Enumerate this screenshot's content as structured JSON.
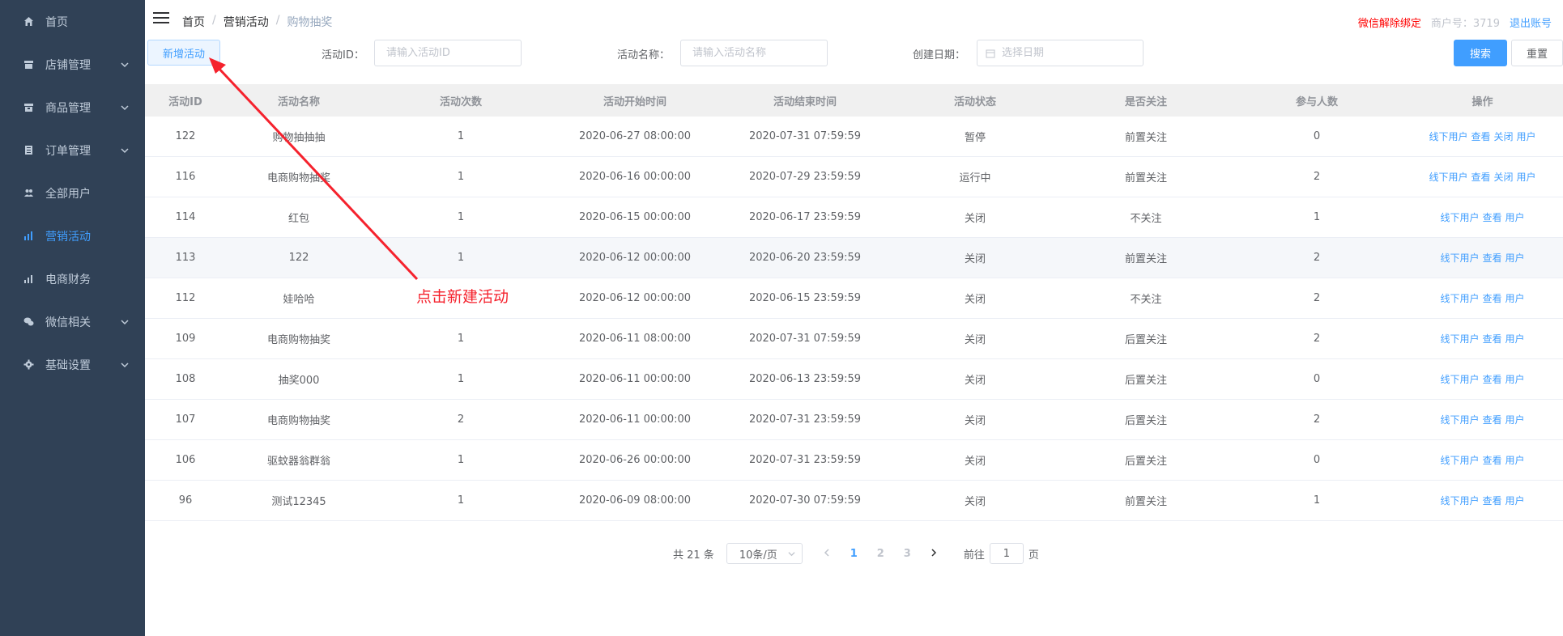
{
  "sidebar": {
    "items": [
      {
        "label": "首页",
        "icon": "home-icon",
        "has_children": false,
        "active": false
      },
      {
        "label": "店铺管理",
        "icon": "store-icon",
        "has_children": true,
        "active": false
      },
      {
        "label": "商品管理",
        "icon": "goods-icon",
        "has_children": true,
        "active": false
      },
      {
        "label": "订单管理",
        "icon": "order-icon",
        "has_children": true,
        "active": false
      },
      {
        "label": "全部用户",
        "icon": "users-icon",
        "has_children": false,
        "active": false
      },
      {
        "label": "营销活动",
        "icon": "chart-icon",
        "has_children": false,
        "active": true
      },
      {
        "label": "电商财务",
        "icon": "finance-icon",
        "has_children": false,
        "active": false
      },
      {
        "label": "微信相关",
        "icon": "wechat-icon",
        "has_children": true,
        "active": false
      },
      {
        "label": "基础设置",
        "icon": "gear-icon",
        "has_children": true,
        "active": false
      }
    ]
  },
  "header": {
    "breadcrumb": [
      "首页",
      "营销活动",
      "购物抽奖"
    ],
    "unbind_wechat": "微信解除绑定",
    "merchant_no": "商户号：3719",
    "logout": "退出账号"
  },
  "filter": {
    "new_button": "新增活动",
    "activity_id_label": "活动ID：",
    "activity_id_placeholder": "请输入活动ID",
    "activity_name_label": "活动名称：",
    "activity_name_placeholder": "请输入活动名称",
    "created_date_label": "创建日期：",
    "created_date_placeholder": "选择日期",
    "search_button": "搜索",
    "reset_button": "重置"
  },
  "table": {
    "columns": [
      "活动ID",
      "活动名称",
      "活动次数",
      "活动开始时间",
      "活动结束时间",
      "活动状态",
      "是否关注",
      "参与人数",
      "操作"
    ],
    "rows": [
      {
        "id": "122",
        "name": "购物抽抽抽",
        "times": "1",
        "start": "2020-06-27 08:00:00",
        "end": "2020-07-31 07:59:59",
        "status": "暂停",
        "follow": "前置关注",
        "people": "0",
        "ops": [
          "线下用户",
          "查看",
          "关闭",
          "用户"
        ]
      },
      {
        "id": "116",
        "name": "电商购物抽奖",
        "times": "1",
        "start": "2020-06-16 00:00:00",
        "end": "2020-07-29 23:59:59",
        "status": "运行中",
        "follow": "前置关注",
        "people": "2",
        "ops": [
          "线下用户",
          "查看",
          "关闭",
          "用户"
        ]
      },
      {
        "id": "114",
        "name": "红包",
        "times": "1",
        "start": "2020-06-15 00:00:00",
        "end": "2020-06-17 23:59:59",
        "status": "关闭",
        "follow": "不关注",
        "people": "1",
        "ops": [
          "线下用户",
          "查看",
          "用户"
        ]
      },
      {
        "id": "113",
        "name": "122",
        "times": "1",
        "start": "2020-06-12 00:00:00",
        "end": "2020-06-20 23:59:59",
        "status": "关闭",
        "follow": "前置关注",
        "people": "2",
        "ops": [
          "线下用户",
          "查看",
          "用户"
        ]
      },
      {
        "id": "112",
        "name": "娃哈哈",
        "times": "",
        "start": "2020-06-12 00:00:00",
        "end": "2020-06-15 23:59:59",
        "status": "关闭",
        "follow": "不关注",
        "people": "2",
        "ops": [
          "线下用户",
          "查看",
          "用户"
        ]
      },
      {
        "id": "109",
        "name": "电商购物抽奖",
        "times": "1",
        "start": "2020-06-11 08:00:00",
        "end": "2020-07-31 07:59:59",
        "status": "关闭",
        "follow": "后置关注",
        "people": "2",
        "ops": [
          "线下用户",
          "查看",
          "用户"
        ]
      },
      {
        "id": "108",
        "name": "抽奖000",
        "times": "1",
        "start": "2020-06-11 00:00:00",
        "end": "2020-06-13 23:59:59",
        "status": "关闭",
        "follow": "后置关注",
        "people": "0",
        "ops": [
          "线下用户",
          "查看",
          "用户"
        ]
      },
      {
        "id": "107",
        "name": "电商购物抽奖",
        "times": "2",
        "start": "2020-06-11 00:00:00",
        "end": "2020-07-31 23:59:59",
        "status": "关闭",
        "follow": "后置关注",
        "people": "2",
        "ops": [
          "线下用户",
          "查看",
          "用户"
        ]
      },
      {
        "id": "106",
        "name": "驱蚊器翁群翁",
        "times": "1",
        "start": "2020-06-26 00:00:00",
        "end": "2020-07-31 23:59:59",
        "status": "关闭",
        "follow": "后置关注",
        "people": "0",
        "ops": [
          "线下用户",
          "查看",
          "用户"
        ]
      },
      {
        "id": "96",
        "name": "测试12345",
        "times": "1",
        "start": "2020-06-09 08:00:00",
        "end": "2020-07-30 07:59:59",
        "status": "关闭",
        "follow": "前置关注",
        "people": "1",
        "ops": [
          "线下用户",
          "查看",
          "用户"
        ]
      }
    ]
  },
  "pagination": {
    "total": "共 21 条",
    "page_size": "10条/页",
    "pages": [
      "1",
      "2",
      "3"
    ],
    "current": "1",
    "goto_prefix": "前往",
    "goto_value": "1",
    "goto_suffix": "页"
  },
  "annotation": {
    "text": "点击新建活动",
    "color": "#f5222d"
  },
  "colors": {
    "sidebar_bg": "#304156",
    "accent": "#409eff"
  }
}
